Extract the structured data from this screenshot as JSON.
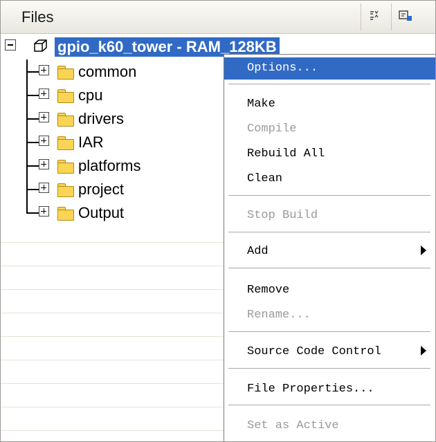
{
  "panel": {
    "title": "Files",
    "header_icons": [
      "view-options-icon",
      "config-icon"
    ]
  },
  "tree": {
    "root": {
      "label": "gpio_k60_tower - RAM_128KB",
      "icon": "project-cube-icon",
      "expanded": true
    },
    "items": [
      {
        "label": "common",
        "icon": "folder-icon"
      },
      {
        "label": "cpu",
        "icon": "folder-icon"
      },
      {
        "label": "drivers",
        "icon": "folder-icon"
      },
      {
        "label": "IAR",
        "icon": "folder-icon"
      },
      {
        "label": "platforms",
        "icon": "folder-icon"
      },
      {
        "label": "project",
        "icon": "folder-icon"
      },
      {
        "label": "Output",
        "icon": "folder-icon"
      }
    ]
  },
  "context_menu": {
    "items": [
      {
        "label": "Options...",
        "mnemonic": "O",
        "state": "highlighted"
      },
      {
        "label": "Make",
        "mnemonic": "M",
        "state": "enabled"
      },
      {
        "label": "Compile",
        "mnemonic": "C",
        "state": "disabled"
      },
      {
        "label": "Rebuild All",
        "mnemonic": "b",
        "state": "enabled"
      },
      {
        "label": "Clean",
        "mnemonic": "l",
        "state": "enabled"
      },
      {
        "label": "Stop Build",
        "mnemonic": "S",
        "state": "disabled"
      },
      {
        "label": "Add",
        "mnemonic": "A",
        "state": "enabled",
        "submenu": true
      },
      {
        "label": "Remove",
        "mnemonic": "v",
        "state": "enabled"
      },
      {
        "label": "Rename...",
        "mnemonic": "R",
        "state": "disabled"
      },
      {
        "label": "Source Code Control",
        "mnemonic": "u",
        "state": "enabled",
        "submenu": true
      },
      {
        "label": "File Properties...",
        "mnemonic": "P",
        "state": "enabled"
      },
      {
        "label": "Set as Active",
        "mnemonic": "e",
        "state": "disabled"
      }
    ]
  },
  "colors": {
    "selection": "#316ac5",
    "folder": "#f9d455",
    "disabled_text": "#9a9a9a"
  }
}
